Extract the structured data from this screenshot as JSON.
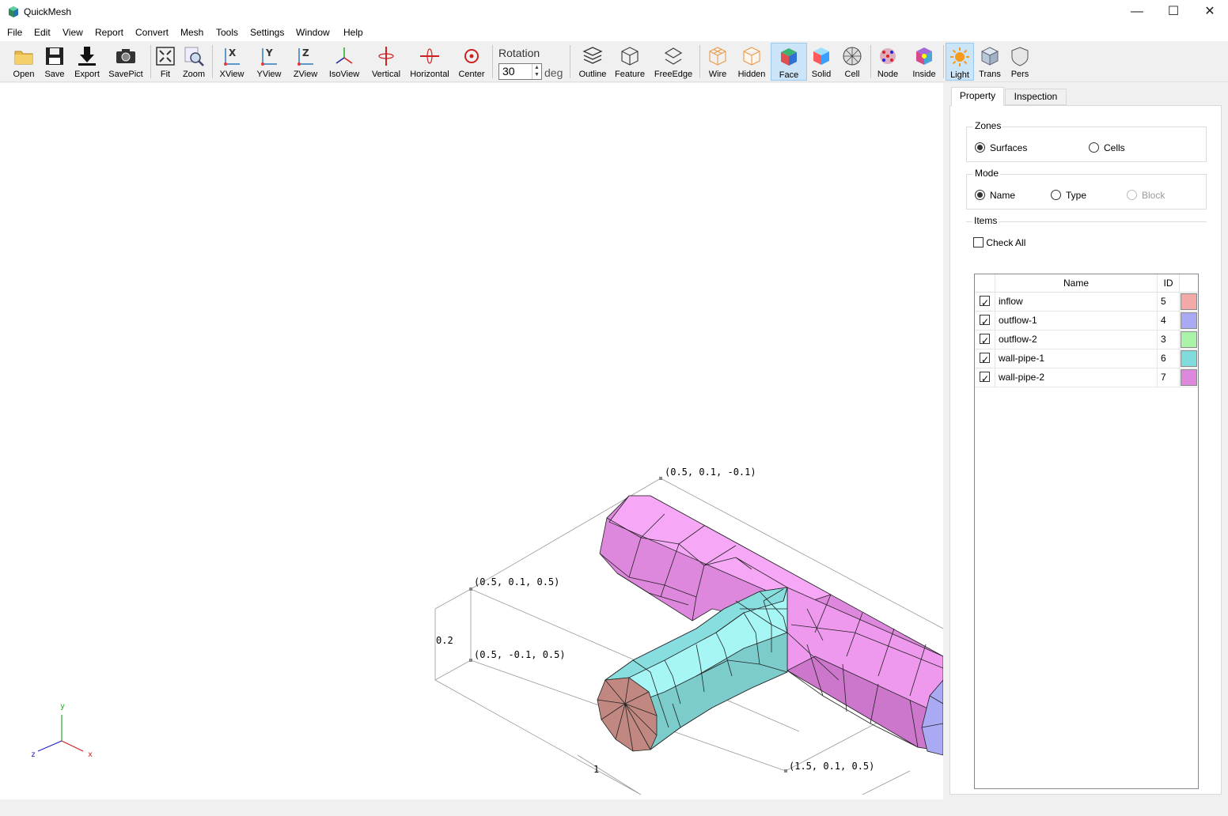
{
  "app": {
    "title": "QuickMesh"
  },
  "window_controls": {
    "minimize": "—",
    "maximize": "☐",
    "close": "✕"
  },
  "menu": [
    "File",
    "Edit",
    "View",
    "Report",
    "Convert",
    "Mesh",
    "Tools",
    "Settings",
    "Window",
    "Help"
  ],
  "toolbar": {
    "open": "Open",
    "save": "Save",
    "export": "Export",
    "savepict": "SavePict",
    "fit": "Fit",
    "zoom": "Zoom",
    "xview": "XView",
    "yview": "YView",
    "zview": "ZView",
    "isoview": "IsoView",
    "vertical": "Vertical",
    "horizontal": "Horizontal",
    "center": "Center",
    "rotation_label": "Rotation",
    "rotation_value": "30",
    "rotation_unit": "deg",
    "outline": "Outline",
    "feature": "Feature",
    "freeedge": "FreeEdge",
    "wire": "Wire",
    "hidden": "Hidden",
    "face": "Face",
    "solid": "Solid",
    "cell": "Cell",
    "node": "Node",
    "inside": "Inside",
    "light": "Light",
    "trans": "Trans",
    "pers": "Pers",
    "active": [
      "face",
      "light"
    ]
  },
  "viewport": {
    "labels": {
      "p1": "(0.5, 0.1, -0.1)",
      "p2": "(0.5, 0.1, 0.5)",
      "p3": "(0.5, -0.1, 0.5)",
      "p4": "(1.5, 0.1, 0.5)",
      "dim_height": "0.2",
      "dim_length": "1"
    },
    "axes": {
      "x": "x",
      "y": "y",
      "z": "z"
    }
  },
  "panel": {
    "tabs": [
      "Property",
      "Inspection"
    ],
    "active_tab": "Property",
    "zones": {
      "title": "Zones",
      "options": [
        "Surfaces",
        "Cells"
      ],
      "selected": "Surfaces"
    },
    "mode": {
      "title": "Mode",
      "options": [
        "Name",
        "Type",
        "Block"
      ],
      "selected": "Name",
      "disabled": [
        "Block"
      ]
    },
    "items": {
      "title": "Items",
      "check_all": "Check All",
      "check_all_checked": false,
      "columns": {
        "name": "Name",
        "id": "ID"
      },
      "rows": [
        {
          "name": "inflow",
          "id": "5",
          "checked": true,
          "color": "#f4a9a9"
        },
        {
          "name": "outflow-1",
          "id": "4",
          "checked": true,
          "color": "#a9a9f4"
        },
        {
          "name": "outflow-2",
          "id": "3",
          "checked": true,
          "color": "#a9f4a9"
        },
        {
          "name": "wall-pipe-1",
          "id": "6",
          "checked": true,
          "color": "#80dcdc"
        },
        {
          "name": "wall-pipe-2",
          "id": "7",
          "checked": true,
          "color": "#dd88dd"
        }
      ]
    }
  }
}
